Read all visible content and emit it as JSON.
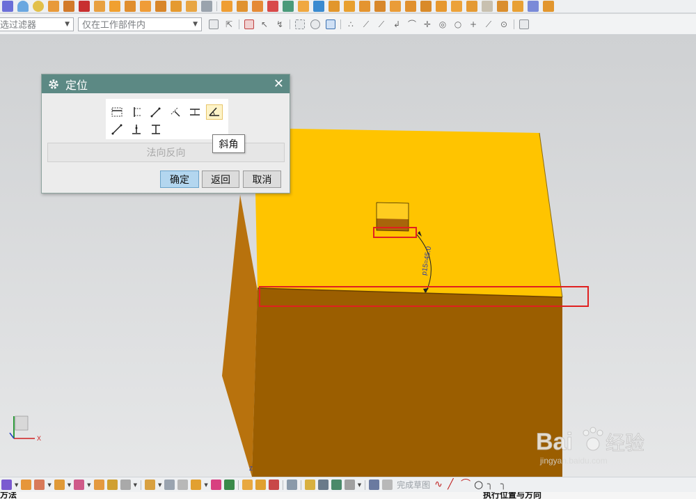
{
  "filter_bar": {
    "type_filter": "选过滤器",
    "scope_filter": "仅在工作部件内"
  },
  "dialog": {
    "title": "定位",
    "close_glyph": "✕",
    "reverse_normal": "法向反向",
    "ok": "确定",
    "back": "返回",
    "cancel": "取消",
    "tooltip": "斜角",
    "tools": [
      "horizontal",
      "vertical",
      "parallel",
      "perpendicular",
      "parallel-at-distance",
      "angular",
      "point-onto-point",
      "point-onto-line",
      "line-onto-line"
    ],
    "active_tool": "angular"
  },
  "viewport": {
    "dimension_label": "p15=45.0",
    "axes": {
      "x": "X",
      "z": "Z"
    }
  },
  "bottom_toolbar": {
    "finish_sketch": "完成草图"
  },
  "status": {
    "left": "方法",
    "right": "执行位置与方向"
  },
  "watermark": {
    "brand": "Bai",
    "brand_cn": "经验",
    "url": "jingyan.baidu.com"
  },
  "colors": {
    "dialog_title": "#5c8984",
    "block_top": "#ffc400",
    "block_front": "#9b5e00",
    "block_side": "#b8720d",
    "highlight": "#e02020"
  }
}
